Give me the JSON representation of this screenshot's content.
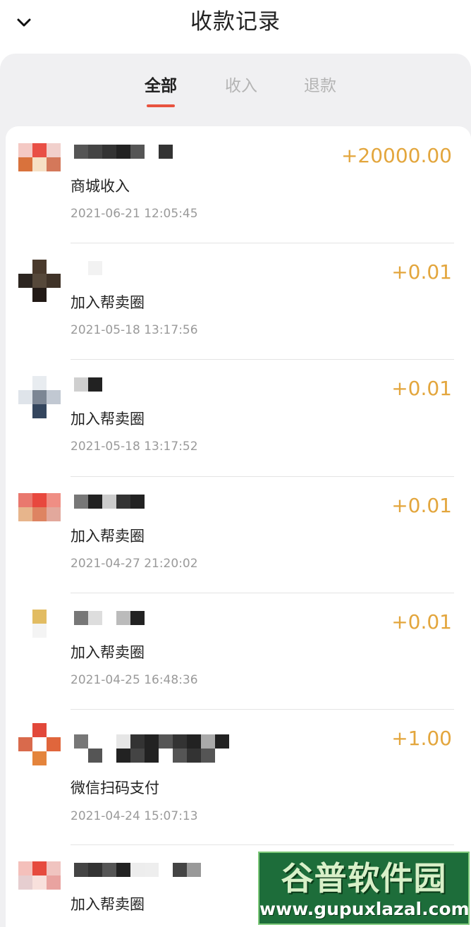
{
  "header": {
    "title": "收款记录",
    "back_icon": "chevron-down-icon"
  },
  "tabs": [
    {
      "label": "全部",
      "active": true
    },
    {
      "label": "收入",
      "active": false
    },
    {
      "label": "退款",
      "active": false
    }
  ],
  "records": [
    {
      "amount": "+20000.00",
      "title": "商城收入",
      "time": "2021-06-21 12:05:45",
      "avatar": [
        "#f4c9c4",
        "#e94f45",
        "#f1d0cc",
        "#d9723c",
        "#f6e0c4",
        "#d4785a",
        "#ffffff",
        "#ffffff",
        "#ffffff"
      ],
      "mask": [
        [
          "#555",
          "#444",
          "#333",
          "#222",
          "#555",
          "",
          "#333"
        ],
        []
      ]
    },
    {
      "amount": "+0.01",
      "title": "加入帮卖圈",
      "time": "2021-05-18 13:17:56",
      "avatar": [
        "#ffffff",
        "#4a3a2c",
        "#ffffff",
        "#2c2520",
        "#56483a",
        "#403328",
        "#ffffff",
        "#221a16",
        "#ffffff"
      ],
      "mask": [
        [
          "",
          "#f2f2f2"
        ],
        []
      ]
    },
    {
      "amount": "+0.01",
      "title": "加入帮卖圈",
      "time": "2021-05-18 13:17:52",
      "avatar": [
        "#ffffff",
        "#e8ecf0",
        "#ffffff",
        "#dfe4ea",
        "#7c8694",
        "#c1c8d2",
        "#ffffff",
        "#34465e",
        "#ffffff"
      ],
      "mask": [
        [
          "#cfcfcf",
          "#222"
        ],
        []
      ]
    },
    {
      "amount": "+0.01",
      "title": "加入帮卖圈",
      "time": "2021-04-27 21:20:02",
      "avatar": [
        "#e9786e",
        "#e8483e",
        "#ef8e84",
        "#e7b58c",
        "#de8462",
        "#e2a89c",
        "#ffffff",
        "#ffffff",
        "#ffffff"
      ],
      "mask": [
        [
          "#777",
          "#222",
          "#ccc",
          "#333",
          "#222"
        ],
        []
      ]
    },
    {
      "amount": "+0.01",
      "title": "加入帮卖圈",
      "time": "2021-04-25 16:48:36",
      "avatar": [
        "#ffffff",
        "#e2bc62",
        "#ffffff",
        "#ffffff",
        "#f4f4f4",
        "#ffffff",
        "#ffffff",
        "#ffffff",
        "#ffffff"
      ],
      "mask": [
        [
          "#777",
          "#ddd",
          "",
          "#bbb",
          "#222"
        ],
        []
      ]
    },
    {
      "amount": "+1.00",
      "title": "微信扫码支付",
      "time": "2021-04-24 15:07:13",
      "avatar": [
        "#ffffff",
        "#e2483a",
        "#ffffff",
        "#d96a4c",
        "#ffffff",
        "#e0663c",
        "#ffffff",
        "#e4843c",
        "#ffffff"
      ],
      "mask": [
        [
          "#777",
          "",
          "",
          "#e6e6e6",
          "#333",
          "#222",
          "#555",
          "#333",
          "#222",
          "#aaa",
          "#222"
        ],
        [
          "",
          "#555",
          "",
          "#222",
          "#444",
          "#222",
          "",
          "#555",
          "#333",
          "#555",
          "",
          "",
          ""
        ]
      ]
    },
    {
      "amount": "",
      "title": "加入帮卖圈",
      "time": "",
      "avatar": [
        "#f4c0bb",
        "#e64a3e",
        "#f0c4c0",
        "#e6ced0",
        "#f8e0dc",
        "#e9a3a0",
        "#ffffff",
        "#ffffff",
        "#ffffff"
      ],
      "mask": [
        [
          "#444",
          "#333",
          "#555",
          "#222",
          "#ededed",
          "#eeeeee",
          "",
          "#444",
          "#999"
        ],
        []
      ]
    }
  ],
  "watermark": {
    "brand": "谷普软件园",
    "url": "www.gupuxlazal.com"
  }
}
